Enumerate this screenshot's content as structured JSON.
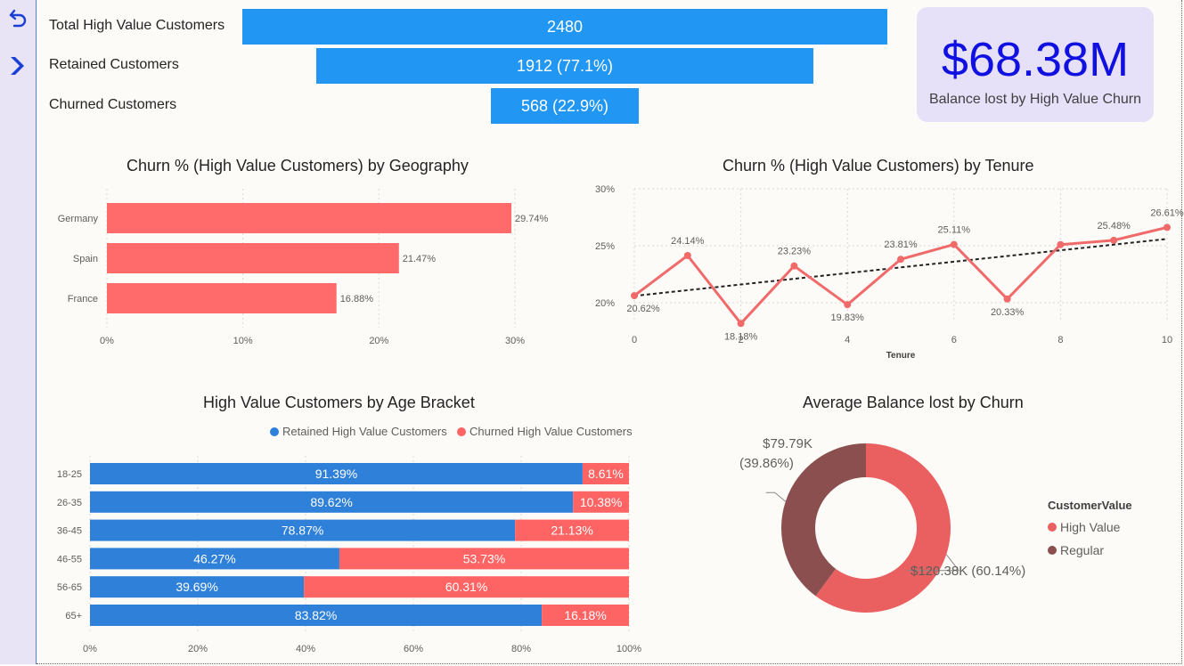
{
  "colors": {
    "funnel_bar": "#2196f3",
    "kpi_value": "#1010e0",
    "churn_bar": "#ff6b6b",
    "retained": "#2f80d8",
    "churned": "#ff6464",
    "high_value_slice": "#ea5f5f",
    "regular_slice": "#8c4f4f",
    "line": "#f06a6a"
  },
  "nav": {
    "back_icon": "back-arrow-icon",
    "next_icon": "chevron-right-icon"
  },
  "funnel": [
    {
      "label": "Total High Value Customers",
      "value": "2480"
    },
    {
      "label": "Retained Customers",
      "value": "1912 (77.1%)"
    },
    {
      "label": "Churned Customers",
      "value": "568 (22.9%)"
    }
  ],
  "kpi": {
    "value": "$68.38M",
    "label": "Balance lost by High Value Churn"
  },
  "geo_chart": {
    "title": "Churn % (High Value Customers) by Geography"
  },
  "tenure_chart": {
    "title": "Churn % (High Value Customers) by Tenure"
  },
  "age_chart": {
    "title": "High Value Customers by Age Bracket",
    "legend": [
      "Retained High Value Customers",
      "Churned High Value Customers"
    ]
  },
  "donut_chart": {
    "title": "Average Balance lost by Churn",
    "legend_title": "CustomerValue",
    "legend": [
      "High Value",
      "Regular"
    ]
  },
  "chart_data": [
    {
      "type": "bar",
      "orientation": "horizontal",
      "title": "Churn % (High Value Customers) by Geography",
      "categories": [
        "Germany",
        "Spain",
        "France"
      ],
      "values": [
        29.74,
        21.47,
        16.88
      ],
      "data_labels": [
        "29.74%",
        "21.47%",
        "16.88%"
      ],
      "xlim": [
        0,
        30
      ],
      "xticks": [
        "0%",
        "10%",
        "20%",
        "30%"
      ],
      "grid": true
    },
    {
      "type": "line",
      "title": "Churn % (High Value Customers) by Tenure",
      "xlabel": "Tenure",
      "x": [
        0,
        1,
        2,
        3,
        4,
        5,
        6,
        7,
        8,
        9,
        10
      ],
      "values": [
        20.62,
        24.14,
        18.18,
        23.23,
        19.83,
        23.81,
        25.11,
        20.33,
        25.1,
        25.48,
        26.61
      ],
      "data_labels": [
        "20.62%",
        "24.14%",
        "18.18%",
        "23.23%",
        "19.83%",
        "23.81%",
        "25.11%",
        "20.33%",
        "",
        "25.48%",
        "26.61%"
      ],
      "ylim": [
        20,
        30
      ],
      "yticks": [
        "20%",
        "25%",
        "30%"
      ],
      "xticks": [
        "0",
        "2",
        "4",
        "6",
        "8",
        "10"
      ],
      "trendline": {
        "start": 20.6,
        "end": 25.6
      },
      "grid": true
    },
    {
      "type": "bar",
      "orientation": "horizontal",
      "stacked": "100%",
      "title": "High Value Customers by Age Bracket",
      "categories": [
        "18-25",
        "26-35",
        "36-45",
        "46-55",
        "56-65",
        "65+"
      ],
      "series": [
        {
          "name": "Retained High Value Customers",
          "values": [
            91.39,
            89.62,
            78.87,
            46.27,
            39.69,
            83.82
          ],
          "labels": [
            "91.39%",
            "89.62%",
            "78.87%",
            "46.27%",
            "39.69%",
            "83.82%"
          ]
        },
        {
          "name": "Churned High Value Customers",
          "values": [
            8.61,
            10.38,
            21.13,
            53.73,
            60.31,
            16.18
          ],
          "labels": [
            "8.61%",
            "10.38%",
            "21.13%",
            "53.73%",
            "60.31%",
            "16.18%"
          ]
        }
      ],
      "xticks": [
        "0%",
        "20%",
        "40%",
        "60%",
        "80%",
        "100%"
      ],
      "legend": "top"
    },
    {
      "type": "pie",
      "donut": true,
      "title": "Average Balance lost by Churn",
      "categories": [
        "High Value",
        "Regular"
      ],
      "values": [
        120.38,
        79.79
      ],
      "labels": [
        "$120.38K (60.14%)",
        "$79.79K",
        "(39.86%)"
      ],
      "legend_title": "CustomerValue",
      "legend": "right"
    }
  ]
}
